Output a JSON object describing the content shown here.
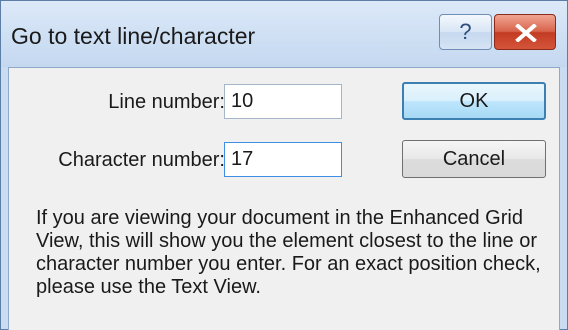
{
  "dialog": {
    "title": "Go to text line/character",
    "help_label": "?",
    "line_label": "Line number:",
    "line_value": "10",
    "char_label": "Character number:",
    "char_value": "17",
    "ok_label": "OK",
    "cancel_label": "Cancel",
    "info": "If you are viewing your document in the Enhanced Grid View, this will show you the element closest to the line or character number you enter. For an exact position check, please use the Text View."
  },
  "colors": {
    "titlebar": "#c9dcf2",
    "close_button": "#c23b22",
    "client_bg": "#f0f0f0",
    "focus_border": "#3d8ee4"
  },
  "icons": {
    "help": "question-icon",
    "close": "close-icon"
  }
}
